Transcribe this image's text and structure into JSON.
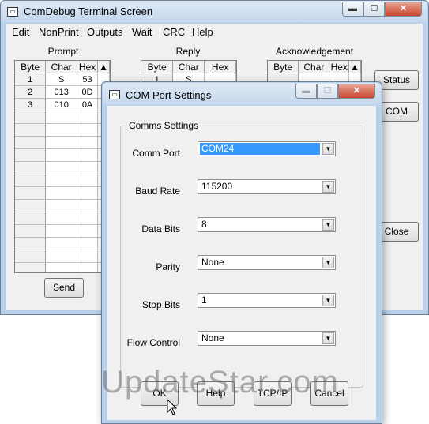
{
  "main_window": {
    "title": "ComDebug Terminal Screen",
    "caption_buttons": {
      "minimize": "▬",
      "maximize": "☐",
      "close": "✕"
    },
    "menu": [
      "Edit",
      "NonPrint",
      "Outputs",
      "Wait",
      "CRC",
      "Help"
    ],
    "prompt": {
      "title": "Prompt",
      "columns": [
        "Byte",
        "Char",
        "Hex"
      ],
      "rows": [
        [
          "1",
          "S",
          "53"
        ],
        [
          "2",
          "013",
          "0D"
        ],
        [
          "3",
          "010",
          "0A"
        ]
      ],
      "send_label": "Send"
    },
    "reply": {
      "title": "Reply",
      "columns": [
        "Byte",
        "Char",
        "Hex"
      ],
      "rows": [
        [
          "1",
          "S",
          ""
        ]
      ]
    },
    "acknowledgement": {
      "title": "Acknowledgement",
      "columns": [
        "Byte",
        "Char",
        "Hex"
      ]
    },
    "side_buttons": {
      "status": "Status",
      "com": "COM",
      "close": "Close"
    }
  },
  "dialog": {
    "title": "COM Port Settings",
    "group_label": "Comms Settings",
    "fields": {
      "comm_port": {
        "label": "Comm Port",
        "value": "COM24"
      },
      "baud_rate": {
        "label": "Baud Rate",
        "value": "115200"
      },
      "data_bits": {
        "label": "Data Bits",
        "value": "8"
      },
      "parity": {
        "label": "Parity",
        "value": "None"
      },
      "stop_bits": {
        "label": "Stop Bits",
        "value": "1"
      },
      "flow_control": {
        "label": "Flow Control",
        "value": "None"
      }
    },
    "buttons": {
      "ok": "OK",
      "help": "Help",
      "tcpip": "TCP/IP",
      "cancel": "Cancel"
    }
  },
  "watermark": "UpdateStar.com",
  "colors": {
    "frame": "#b9d1ea",
    "selection": "#3399ff",
    "close_button": "#c7452d"
  }
}
